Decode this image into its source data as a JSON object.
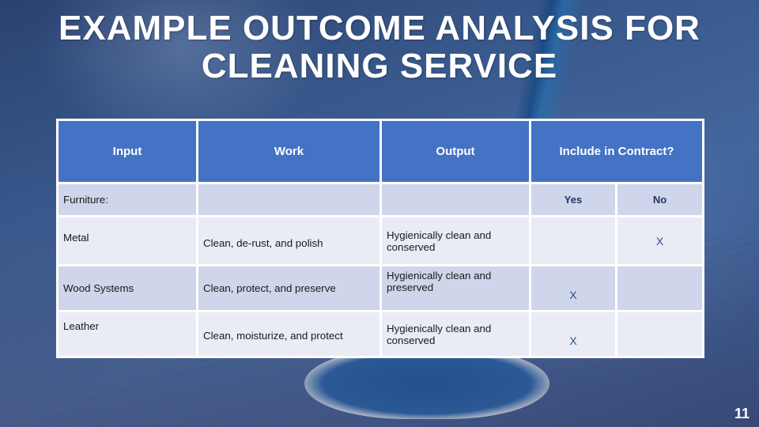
{
  "slide": {
    "title_line1": "EXAMPLE OUTCOME ANALYSIS FOR",
    "title_line2": "CLEANING SERVICE",
    "page_number": "11"
  },
  "colors": {
    "header_bg": "#4472c4",
    "row_dark": "#cfd5ea",
    "row_light": "#e9ebf5",
    "subheader_text": "#1f3864"
  },
  "table": {
    "headers": [
      "Input",
      "Work",
      "Output",
      "Include in Contract?"
    ],
    "group_label": "Furniture:",
    "subheaders": {
      "yes": "Yes",
      "no": "No"
    },
    "rows": [
      {
        "input": "Metal",
        "work": "Clean, de-rust, and polish",
        "output": "Hygienically clean and conserved",
        "yes": "",
        "no": "X"
      },
      {
        "input": "Wood Systems",
        "work": "Clean, protect, and preserve",
        "output": "Hygienically clean and preserved",
        "yes": "X",
        "no": ""
      },
      {
        "input": "Leather",
        "work": "Clean, moisturize, and protect",
        "output": "Hygienically clean and conserved",
        "yes": "X",
        "no": ""
      }
    ]
  }
}
